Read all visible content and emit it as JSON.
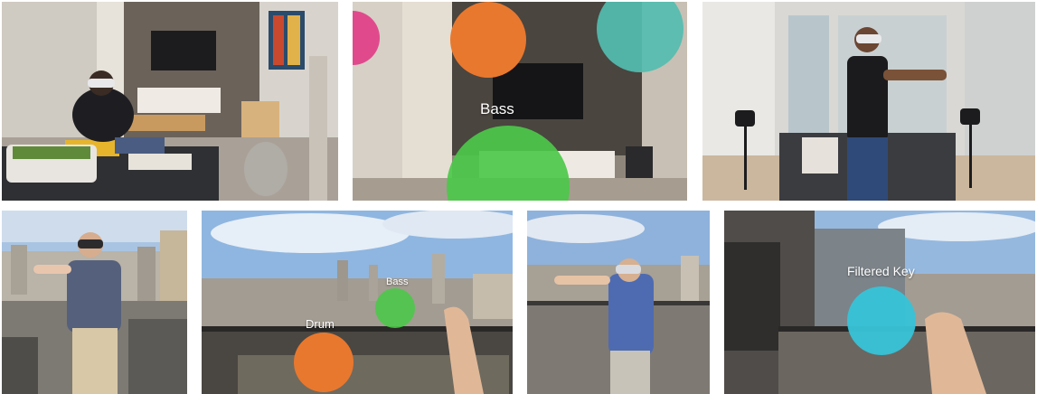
{
  "labels": {
    "top_middle_bass": "Bass",
    "bottom_two_bass": "Bass",
    "bottom_two_drum": "Drum",
    "bottom_four_filtered_key": "Filtered Key"
  },
  "colors": {
    "orange_ball": "#e8782e",
    "green_ball": "#4cc84a",
    "teal_ball": "#52bdb0",
    "pink_ball": "#e04a8c",
    "cyan_ball": "#37c3d8",
    "sky": "#8fb6e0"
  }
}
